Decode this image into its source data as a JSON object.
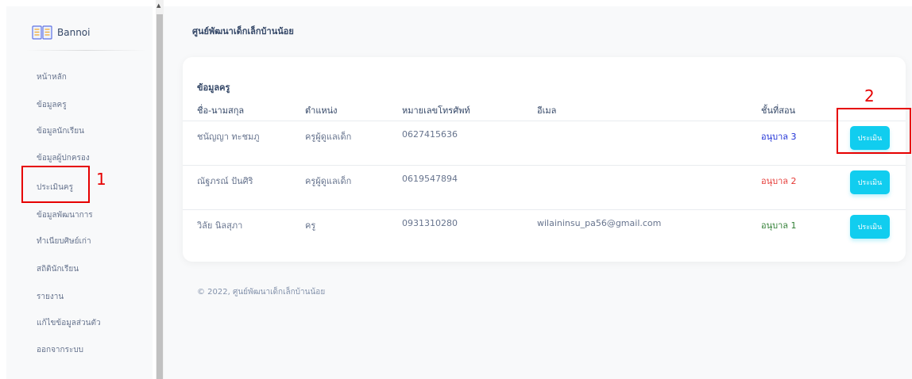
{
  "brand": {
    "name": "Bannoi",
    "icon": "book-icon"
  },
  "sidebar": {
    "items": [
      {
        "label": "หน้าหลัก"
      },
      {
        "label": "ข้อมูลครู"
      },
      {
        "label": "ข้อมูลนักเรียน"
      },
      {
        "label": "ข้อมูลผู้ปกครอง"
      },
      {
        "label": "ประเมินครู"
      },
      {
        "label": "ข้อมูลพัฒนาการ"
      },
      {
        "label": "ทำเนียบศิษย์เก่า"
      },
      {
        "label": "สถิตินักเรียน"
      },
      {
        "label": "รายงาน"
      },
      {
        "label": "แก้ไขข้อมูลส่วนตัว"
      },
      {
        "label": "ออกจากระบบ"
      }
    ]
  },
  "header": {
    "title": "ศูนย์พัฒนาเด็กเล็กบ้านน้อย"
  },
  "card": {
    "title": "ข้อมูลครู",
    "columns": [
      "ชื่อ-นามสกุล",
      "ตำแหน่ง",
      "หมายเลขโทรศัพท์",
      "อีเมล",
      "ชั้นที่สอน"
    ],
    "rows": [
      {
        "name": "ชนัญญา ทะชมภู",
        "position": "ครูผู้ดูแลเด็ก",
        "phone": "0627415636",
        "email": "",
        "level_word": "อนุบาล",
        "level_num": "3",
        "level_color": "#1d2fd6",
        "action": "ประเมิน"
      },
      {
        "name": "ณัฐภรณ์ ปันศิริ",
        "position": "ครูผู้ดูแลเด็ก",
        "phone": "0619547894",
        "email": "",
        "level_word": "อนุบาล",
        "level_num": "2",
        "level_color": "#e53935",
        "action": "ประเมิน"
      },
      {
        "name": "วิลัย นิลสุภา",
        "position": "ครู",
        "phone": "0931310280",
        "email": "wilaininsu_pa56@gmail.com",
        "level_word": "อนุบาล",
        "level_num": "1",
        "level_color": "#2e7d32",
        "action": "ประเมิน"
      }
    ]
  },
  "footer": {
    "text": "© 2022, ศูนย์พัฒนาเด็กเล็กบ้านน้อย"
  },
  "annotations": {
    "first": "1",
    "second": "2"
  },
  "colors": {
    "accent": "#11cdef",
    "annotation": "#e60000"
  }
}
